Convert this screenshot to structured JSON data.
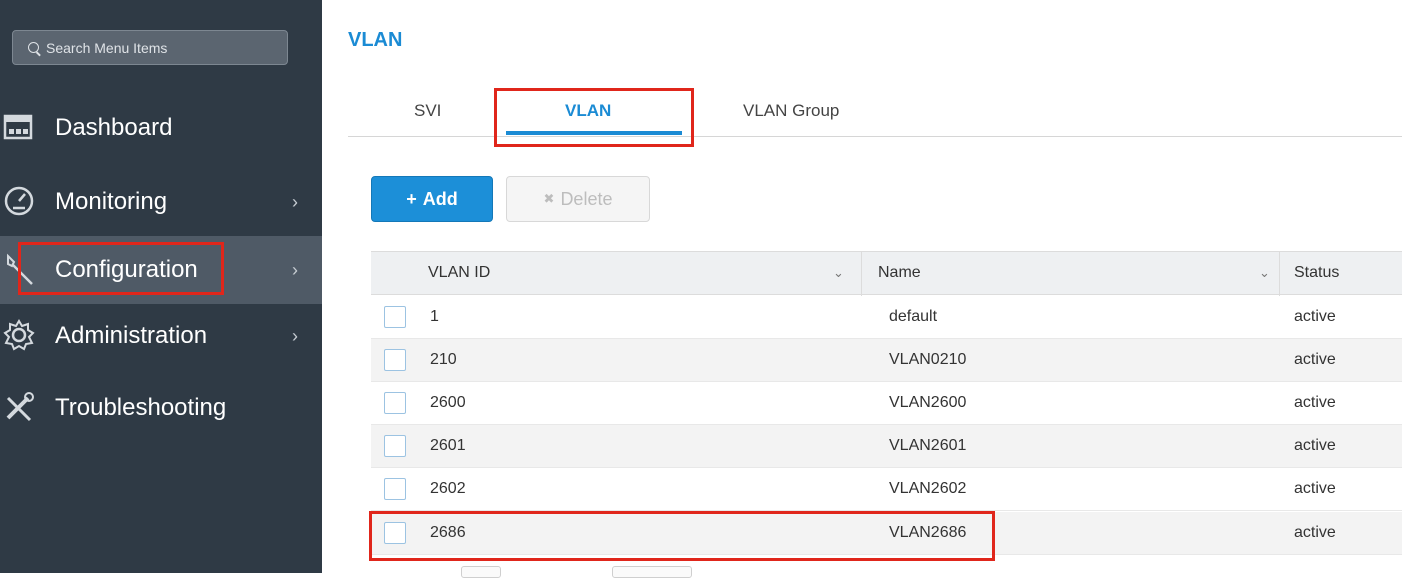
{
  "sidebar": {
    "search_placeholder": "Search Menu Items",
    "items": [
      {
        "label": "Dashboard",
        "icon": "dashboard-icon",
        "has_chevron": false
      },
      {
        "label": "Monitoring",
        "icon": "gauge-icon",
        "has_chevron": true
      },
      {
        "label": "Configuration",
        "icon": "wrench-icon",
        "has_chevron": true
      },
      {
        "label": "Administration",
        "icon": "gear-icon",
        "has_chevron": true
      },
      {
        "label": "Troubleshooting",
        "icon": "tools-icon",
        "has_chevron": false
      }
    ],
    "chevron": "›"
  },
  "page": {
    "title": "VLAN",
    "tabs": [
      "SVI",
      "VLAN",
      "VLAN Group"
    ],
    "active_tab": "VLAN"
  },
  "toolbar": {
    "add_icon": "+",
    "add_label": "Add",
    "delete_icon": "✖",
    "delete_label": "Delete"
  },
  "table": {
    "columns": [
      "VLAN ID",
      "Name",
      "Status"
    ],
    "sort_glyph": "⌄",
    "rows": [
      {
        "id": "1",
        "name": "default",
        "status": "active"
      },
      {
        "id": "210",
        "name": "VLAN0210",
        "status": "active"
      },
      {
        "id": "2600",
        "name": "VLAN2600",
        "status": "active"
      },
      {
        "id": "2601",
        "name": "VLAN2601",
        "status": "active"
      },
      {
        "id": "2602",
        "name": "VLAN2602",
        "status": "active"
      },
      {
        "id": "2686",
        "name": "VLAN2686",
        "status": "active"
      }
    ]
  },
  "colors": {
    "accent": "#1b8bd4",
    "sidebar_bg": "#2f3a45",
    "highlight_border": "#e0261b"
  }
}
